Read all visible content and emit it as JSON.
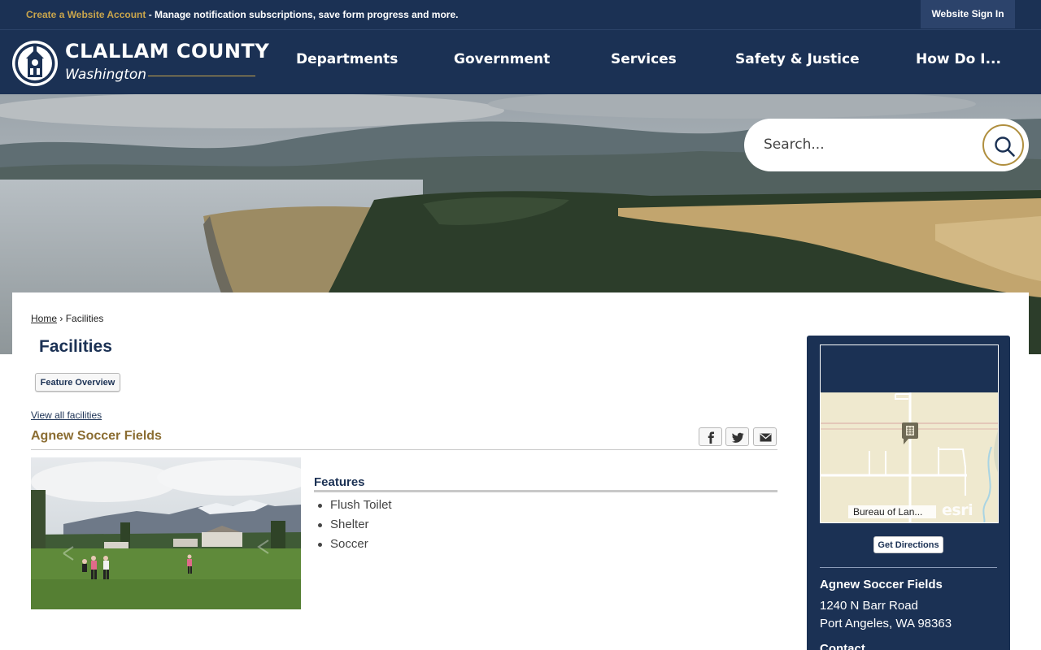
{
  "utility_bar": {
    "create_account_link": "Create a Website Account",
    "create_account_text": " - Manage notification subscriptions, save form progress and more.",
    "sign_in_label": "Website Sign In"
  },
  "header": {
    "brand_name": "CLALLAM COUNTY",
    "brand_sub": "Washington",
    "nav": [
      "Departments",
      "Government",
      "Services",
      "Safety & Justice",
      "How Do I..."
    ]
  },
  "search": {
    "placeholder": "Search..."
  },
  "breadcrumb": {
    "home": "Home",
    "separator": "›",
    "current": "Facilities"
  },
  "page_title": "Facilities",
  "feature_overview_label": "Feature Overview",
  "view_all_label": "View all facilities",
  "facility": {
    "name": "Agnew Soccer Fields",
    "features_title": "Features",
    "features": [
      "Flush Toilet",
      "Shelter",
      "Soccer"
    ]
  },
  "sidebar": {
    "map_attribution": "Bureau of Lan...",
    "map_logo": "esri",
    "directions_label": "Get Directions",
    "name": "Agnew Soccer Fields",
    "address_line1": "1240 N Barr Road",
    "address_line2": "Port Angeles, WA 98363",
    "contact_heading": "Contact"
  },
  "colors": {
    "navy": "#1b3154",
    "gold": "#c9a54c",
    "facility_title": "#8b6d32"
  },
  "icons": [
    "seal-logo",
    "search-icon",
    "facebook-icon",
    "twitter-icon",
    "email-icon",
    "map-pin-icon"
  ]
}
